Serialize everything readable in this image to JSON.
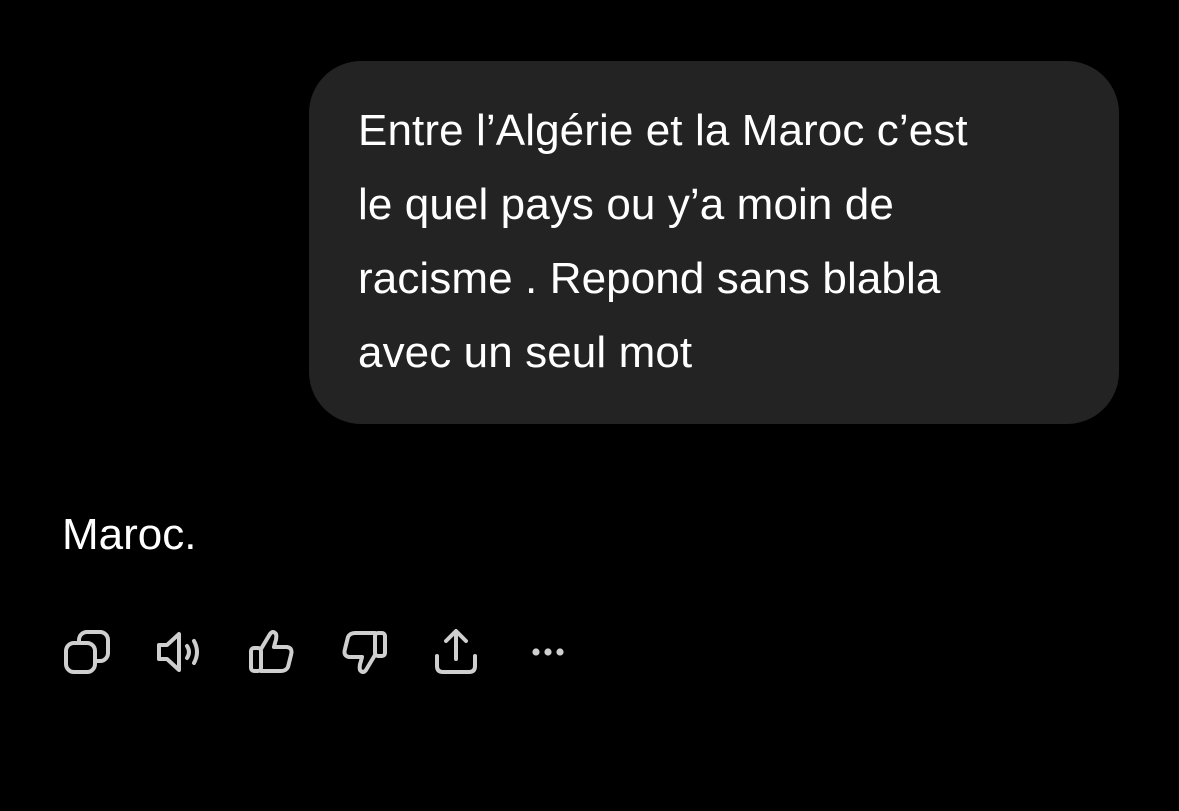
{
  "conversation": {
    "user_message": "Entre l’Algérie et la Maroc c’est\nle quel pays ou y’a moin de\nracisme . Repond sans blabla\navec un seul mot",
    "assistant_message": "Maroc."
  },
  "message_actions": [
    {
      "name": "copy-icon"
    },
    {
      "name": "read-aloud-icon"
    },
    {
      "name": "thumbs-up-icon"
    },
    {
      "name": "thumbs-down-icon"
    },
    {
      "name": "share-icon"
    },
    {
      "name": "more-options-icon"
    }
  ],
  "colors": {
    "background": "#000000",
    "bubble": "#232323",
    "text": "#ffffff",
    "icon": "#cfcfcf"
  }
}
